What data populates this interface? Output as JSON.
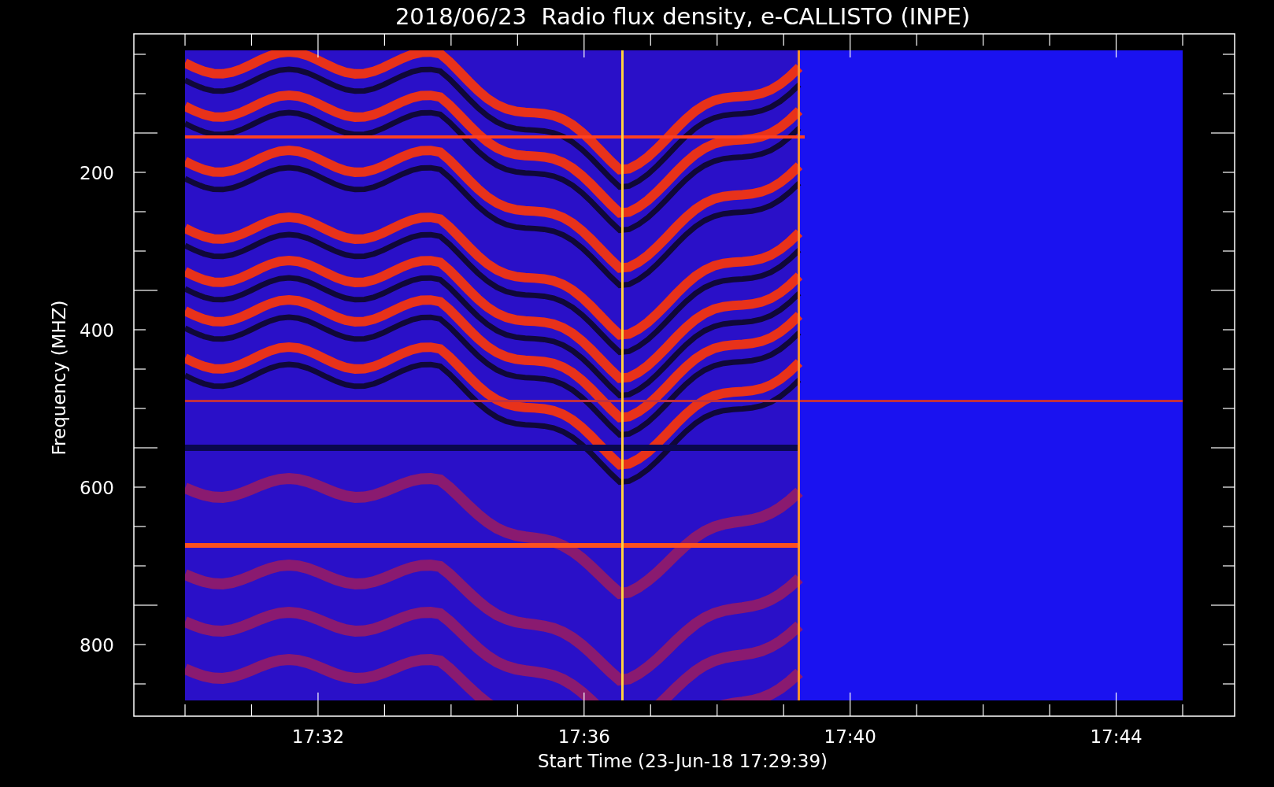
{
  "title": "2018/06/23  Radio flux density, e-CALLISTO (INPE)",
  "x_axis": {
    "label": "Start Time (23-Jun-18 17:29:39)",
    "ticks": [
      "17:32",
      "17:36",
      "17:40",
      "17:44"
    ]
  },
  "y_axis": {
    "label": "Frequency (MHZ)",
    "ticks": [
      "200",
      "400",
      "600",
      "800"
    ]
  }
}
